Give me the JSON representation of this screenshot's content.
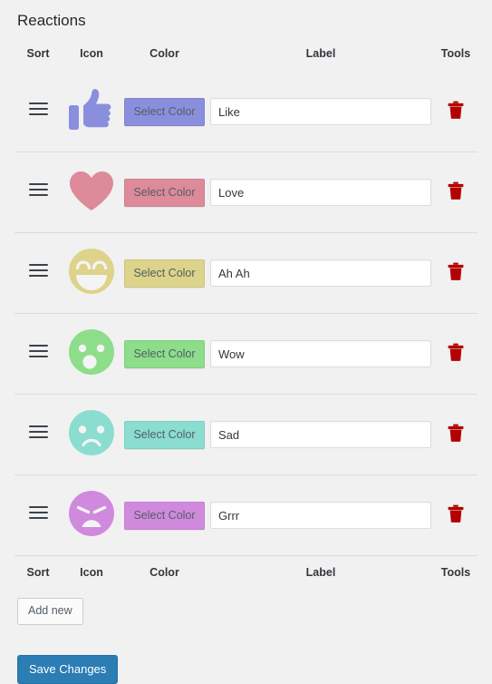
{
  "page": {
    "title": "Reactions"
  },
  "table": {
    "headers": {
      "sort": "Sort",
      "icon": "Icon",
      "color": "Color",
      "label": "Label",
      "tools": "Tools"
    },
    "select_color_label": "Select Color",
    "rows": [
      {
        "icon": "thumbs-up-icon",
        "color": "#8a8fdd",
        "label_value": "Like",
        "select_color_label": "Select Color",
        "delete_icon": "trash-icon"
      },
      {
        "icon": "heart-icon",
        "color": "#dd8a9a",
        "label_value": "Love",
        "select_color_label": "Select Color",
        "delete_icon": "trash-icon"
      },
      {
        "icon": "laughing-face-icon",
        "color": "#ddd38a",
        "label_value": "Ah Ah",
        "select_color_label": "Select Color",
        "delete_icon": "trash-icon"
      },
      {
        "icon": "surprised-face-icon",
        "color": "#8ddd8a",
        "label_value": "Wow",
        "select_color_label": "Select Color",
        "delete_icon": "trash-icon"
      },
      {
        "icon": "sad-face-icon",
        "color": "#8addcf",
        "label_value": "Sad",
        "select_color_label": "Select Color",
        "delete_icon": "trash-icon"
      },
      {
        "icon": "angry-face-icon",
        "color": "#d08add",
        "label_value": "Grrr",
        "select_color_label": "Select Color",
        "delete_icon": "trash-icon"
      }
    ]
  },
  "footer": {
    "add_new_label": "Add new",
    "save_changes_label": "Save Changes"
  },
  "colors": {
    "background": "#f1f1f1",
    "heading": "#23282d",
    "trash": "#b30000",
    "save_button": "#2b7db3",
    "border": "#dcdcdc"
  }
}
